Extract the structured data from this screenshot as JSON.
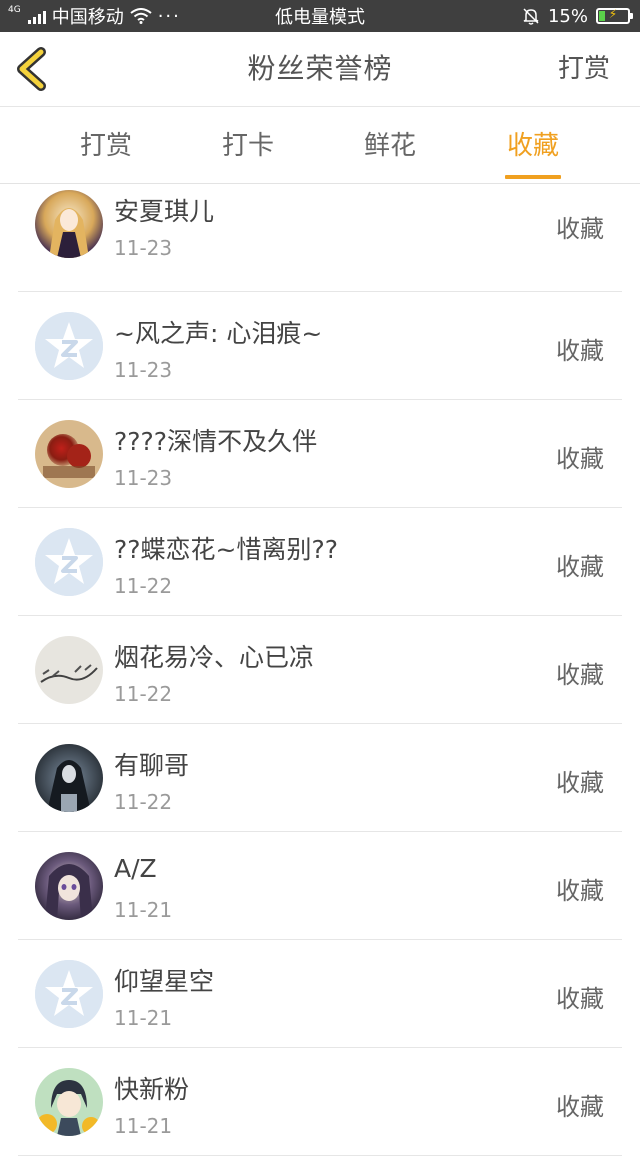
{
  "status_bar": {
    "network": "4G",
    "carrier": "中国移动",
    "mode": "低电量模式",
    "battery": "15%",
    "battery_level": 0.15
  },
  "header": {
    "title": "粉丝荣誉榜",
    "action": "打赏"
  },
  "tabs": [
    {
      "label": "打赏",
      "active": false
    },
    {
      "label": "打卡",
      "active": false
    },
    {
      "label": "鲜花",
      "active": false
    },
    {
      "label": "收藏",
      "active": true
    }
  ],
  "list": [
    {
      "name": "安夏琪儿",
      "date": "11-23",
      "action": "收藏",
      "avatar": "anime-girl-avatar"
    },
    {
      "name": "~风之声: 心泪痕~",
      "date": "11-23",
      "action": "收藏",
      "avatar": "default-qq-avatar"
    },
    {
      "name": "????深情不及久伴",
      "date": "11-23",
      "action": "收藏",
      "avatar": "red-roses-avatar"
    },
    {
      "name": "??蝶恋花~惜离别??",
      "date": "11-22",
      "action": "收藏",
      "avatar": "default-qq-avatar"
    },
    {
      "name": "烟花易冷、心已凉",
      "date": "11-22",
      "action": "收藏",
      "avatar": "handwriting-avatar"
    },
    {
      "name": "有聊哥",
      "date": "11-22",
      "action": "收藏",
      "avatar": "dark-anime-avatar"
    },
    {
      "name": "A/Z",
      "date": "11-21",
      "action": "收藏",
      "avatar": "purple-anime-avatar"
    },
    {
      "name": "仰望星空",
      "date": "11-21",
      "action": "收藏",
      "avatar": "default-qq-avatar"
    },
    {
      "name": "快新粉",
      "date": "11-21",
      "action": "收藏",
      "avatar": "anime-boy-sunflower-avatar"
    }
  ],
  "colors": {
    "accent": "#f0a020",
    "status_bar": "#3f3f3f",
    "default_avatar": "#dbe6f2"
  }
}
